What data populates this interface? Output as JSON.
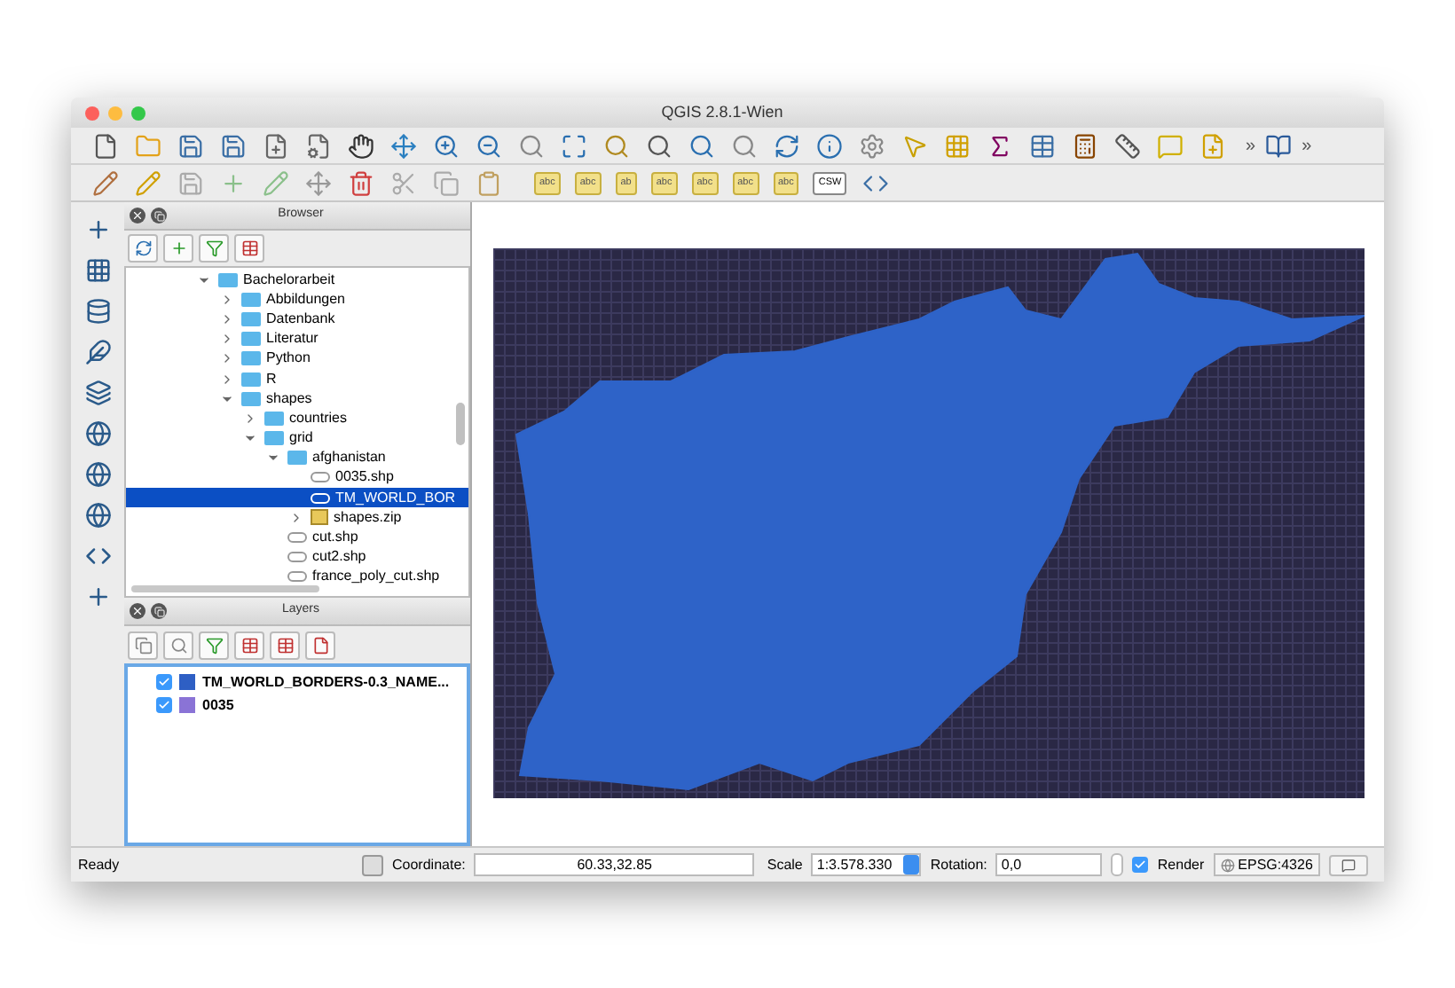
{
  "window": {
    "title": "QGIS 2.8.1-Wien"
  },
  "browser": {
    "title": "Browser",
    "tree": [
      {
        "label": "Bachelorarbeit",
        "kind": "folder",
        "expanded": true,
        "selected": false,
        "children": [
          {
            "label": "Abbildungen",
            "kind": "folder",
            "expanded": false,
            "selected": false
          },
          {
            "label": "Datenbank",
            "kind": "folder",
            "expanded": false,
            "selected": false
          },
          {
            "label": "Literatur",
            "kind": "folder",
            "expanded": false,
            "selected": false
          },
          {
            "label": "Python",
            "kind": "folder",
            "expanded": false,
            "selected": false
          },
          {
            "label": "R",
            "kind": "folder",
            "expanded": false,
            "selected": false
          },
          {
            "label": "shapes",
            "kind": "folder",
            "expanded": true,
            "selected": false,
            "children": [
              {
                "label": "countries",
                "kind": "folder",
                "expanded": false,
                "selected": false
              },
              {
                "label": "grid",
                "kind": "folder",
                "expanded": true,
                "selected": false,
                "children": [
                  {
                    "label": "afghanistan",
                    "kind": "folder",
                    "expanded": true,
                    "selected": false,
                    "children": [
                      {
                        "label": "0035.shp",
                        "kind": "file",
                        "selected": false
                      },
                      {
                        "label": "TM_WORLD_BOR",
                        "kind": "file",
                        "selected": true
                      },
                      {
                        "label": "shapes.zip",
                        "kind": "zip",
                        "expanded": false,
                        "selected": false
                      }
                    ]
                  },
                  {
                    "label": "cut.shp",
                    "kind": "file",
                    "selected": false
                  },
                  {
                    "label": "cut2.shp",
                    "kind": "file",
                    "selected": false
                  },
                  {
                    "label": "france_poly_cut.shp",
                    "kind": "file",
                    "selected": false
                  }
                ]
              }
            ]
          }
        ]
      }
    ]
  },
  "layers": {
    "title": "Layers",
    "items": [
      {
        "name": "TM_WORLD_BORDERS-0.3_NAME...",
        "checked": true,
        "color": "#2e5fc4"
      },
      {
        "name": "0035",
        "checked": true,
        "color": "#8a73d6"
      }
    ]
  },
  "status_bar": {
    "message": "Ready",
    "coordinate_label": "Coordinate:",
    "coordinate": "60.33,32.85",
    "scale_label": "Scale",
    "scale": "1:3.578.330",
    "rotation_label": "Rotation:",
    "rotation": "0,0",
    "render_label": "Render",
    "render": true,
    "crs": "EPSG:4326"
  },
  "toolbar2_labels": [
    "abc",
    "abc",
    "ab",
    "abc",
    "abc",
    "abc",
    "abc",
    "CSW"
  ],
  "overflow": [
    "»",
    "»"
  ]
}
